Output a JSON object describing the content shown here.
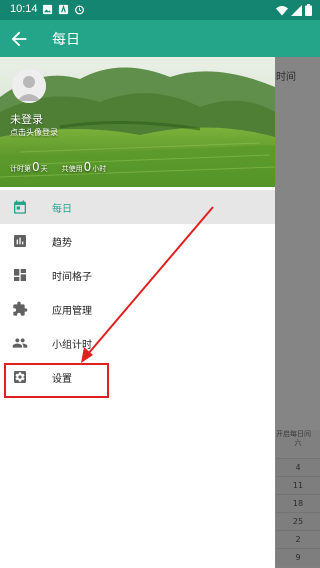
{
  "status_bar": {
    "time": "10:14",
    "left_icons": [
      "image-icon",
      "a-badge-icon",
      "alarm-icon"
    ],
    "right_icons": [
      "wifi-icon",
      "signal-icon",
      "battery-icon"
    ]
  },
  "app_bar": {
    "title": "每日",
    "back_icon": "arrow-left-icon"
  },
  "drawer": {
    "header": {
      "user_name": "未登录",
      "login_hint": "点击头像登录",
      "stats": {
        "timed_label": "计时第",
        "timed_value": "0",
        "timed_unit": "天",
        "used_label": "共使用",
        "used_value": "0",
        "used_unit": "小时"
      }
    },
    "menu": [
      {
        "label": "每日",
        "icon": "calendar-icon",
        "active": true
      },
      {
        "label": "趋势",
        "icon": "bar-chart-icon",
        "active": false
      },
      {
        "label": "时间格子",
        "icon": "dashboard-grid-icon",
        "active": false
      },
      {
        "label": "应用管理",
        "icon": "puzzle-icon",
        "active": false
      },
      {
        "label": "小组计时",
        "icon": "group-icon",
        "active": false
      },
      {
        "label": "设置",
        "icon": "settings-icon",
        "active": false
      }
    ]
  },
  "background": {
    "time_label": "时间",
    "calendar_header": "开启每日间",
    "calendar_weekday": "六",
    "calendar_days": [
      "4",
      "11",
      "18",
      "25",
      "2",
      "9"
    ]
  },
  "colors": {
    "primary": "#24a58a",
    "status_bar": "#148570",
    "annotation": "#e02020"
  }
}
